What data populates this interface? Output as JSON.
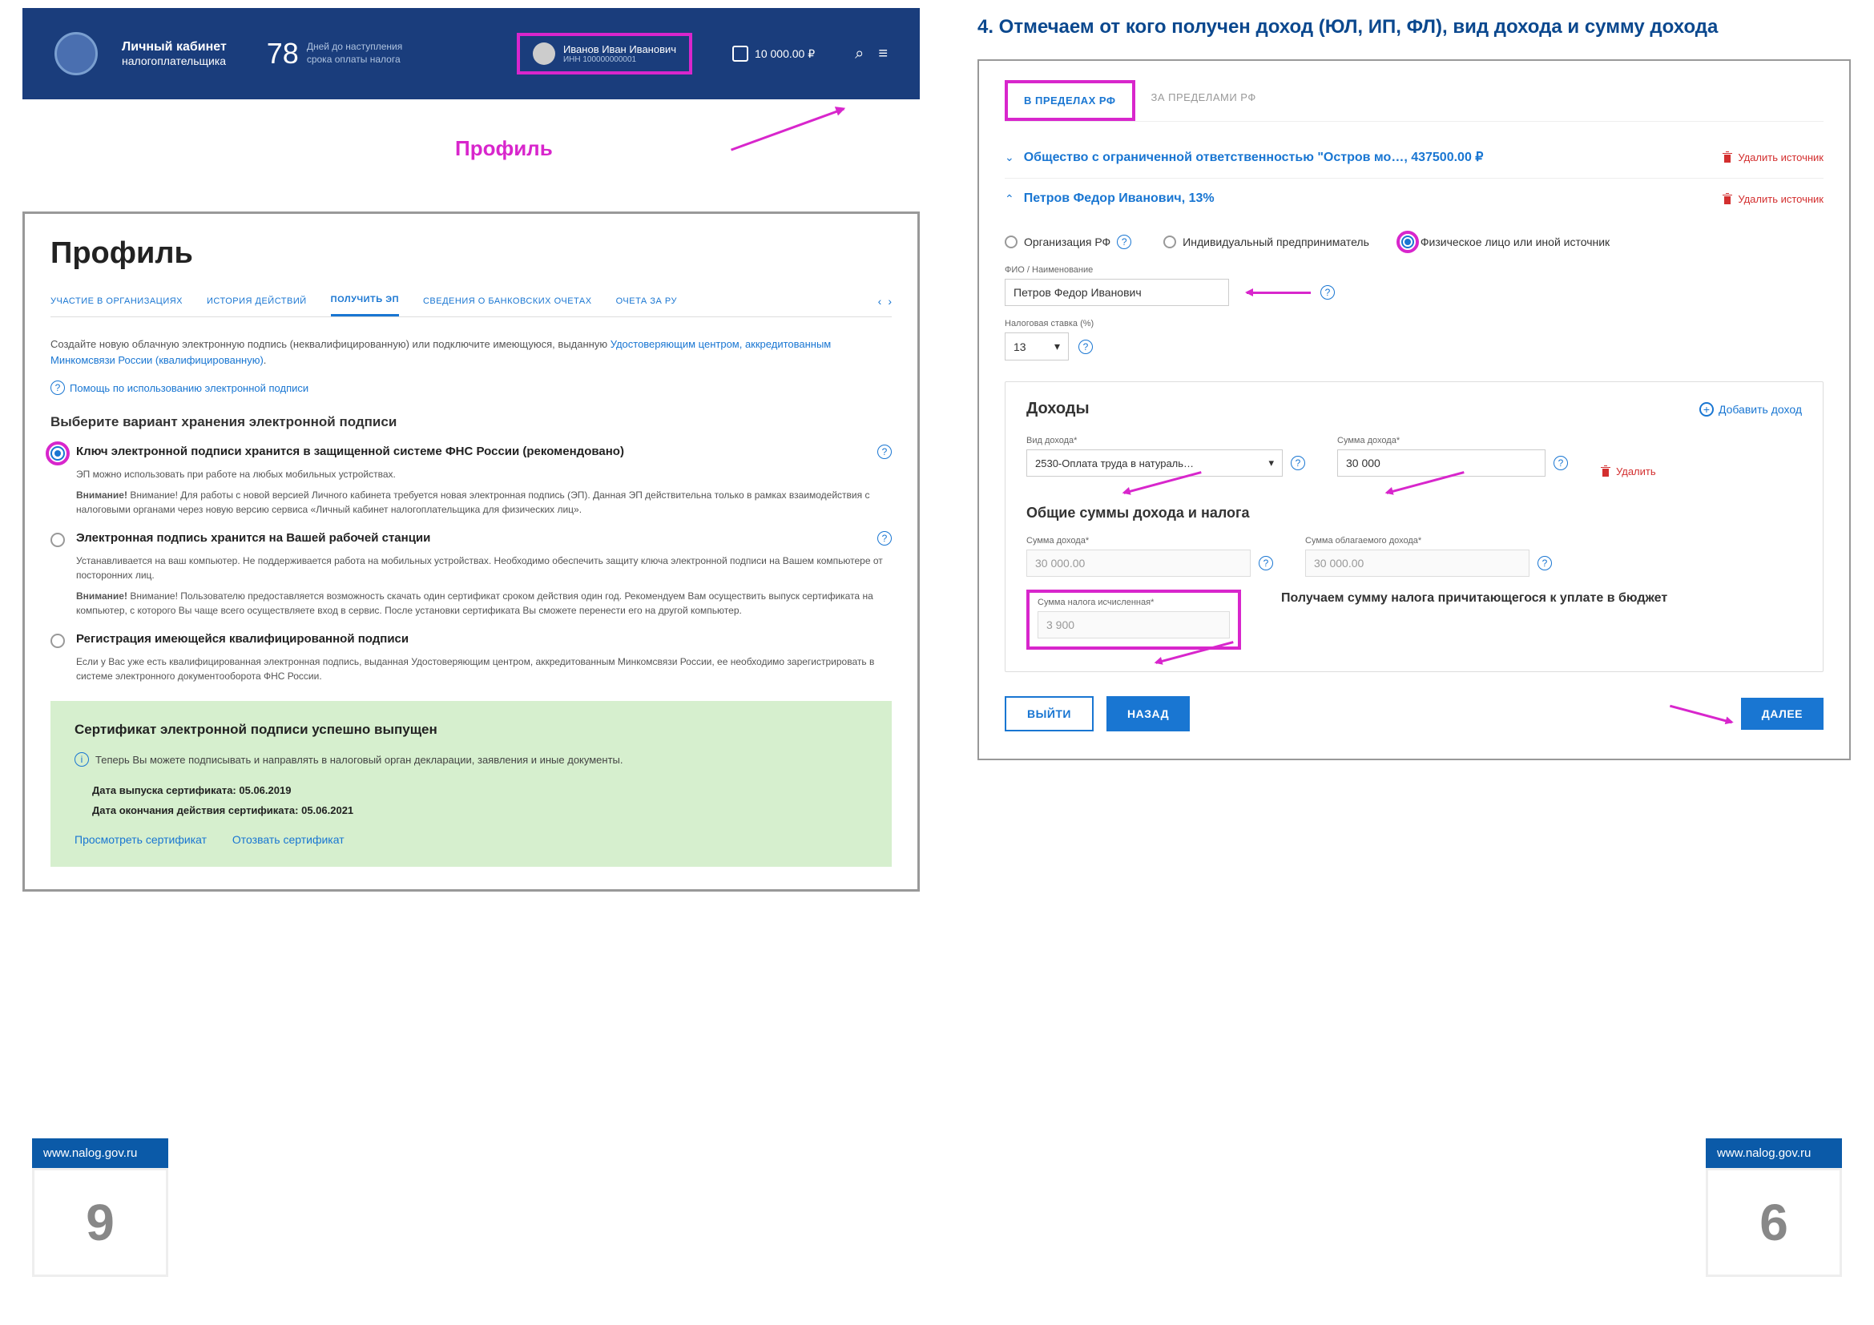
{
  "left": {
    "header": {
      "title1": "Личный кабинет",
      "title2": "налогоплательщика",
      "days_num": "78",
      "days_txt1": "Дней до наступления",
      "days_txt2": "срока оплаты налога",
      "user_name": "Иванов Иван Иванович",
      "user_inn": "ИНН 100000000001",
      "amount": "10 000.00 ₽"
    },
    "profile_label": "Профиль",
    "profile_h": "Профиль",
    "tabs": [
      "УЧАСТИЕ В ОРГАНИЗАЦИЯХ",
      "ИСТОРИЯ ДЕЙСТВИЙ",
      "ПОЛУЧИТЬ ЭП",
      "СВЕДЕНИЯ О БАНКОВСКИХ ОЧЕТАХ",
      "ОЧЕТА ЗА РУ"
    ],
    "intro": "Создайте новую облачную электронную подпись (неквалифицированную) или подключите имеющуюся, выданную ",
    "intro_link": "Удостоверяющим центром, аккредитованным Минкомсвязи России (квалифицированную)",
    "help": "Помощь по использованию электронной подписи",
    "choose_h": "Выберите вариант хранения электронной подписи",
    "opt1": {
      "title": "Ключ электронной подписи хранится в защищенной системе ФНС России (рекомендовано)",
      "desc": "ЭП можно использовать при работе на любых мобильных устройствах.",
      "warn": "Внимание! Для работы с новой версией Личного кабинета требуется новая электронная подпись (ЭП). Данная ЭП действительна только в рамках взаимодействия с налоговыми органами через новую версию сервиса «Личный кабинет налогоплательщика для физических лиц»."
    },
    "opt2": {
      "title": "Электронная подпись хранится на Вашей рабочей станции",
      "desc": "Устанавливается на ваш компьютер. Не поддерживается работа на мобильных устройствах. Необходимо обеспечить защиту ключа электронной подписи на Вашем компьютере от посторонних лиц.",
      "warn": "Внимание! Пользователю предоставляется возможность скачать один сертификат сроком действия один год. Рекомендуем Вам осуществить выпуск сертификата на компьютер, с которого Вы чаще всего осуществляете вход в сервис. После установки сертификата Вы сможете перенести его на другой компьютер."
    },
    "opt3": {
      "title": "Регистрация имеющейся квалифицированной подписи",
      "desc": "Если у Вас уже есть квалифицированная электронная подпись, выданная Удостоверяющим центром, аккредитованным Минкомсвязи России, ее необходимо зарегистрировать в системе электронного документооборота ФНС России."
    },
    "cert": {
      "title": "Сертификат электронной подписи успешно выпущен",
      "msg": "Теперь Вы можете подписывать и направлять в налоговый орган декларации, заявления и иные документы.",
      "date1_label": "Дата выпуска сертификата:",
      "date1": "05.06.2019",
      "date2_label": "Дата окончания действия сертификата:",
      "date2": "05.06.2021",
      "link1": "Просмотреть сертификат",
      "link2": "Отозвать сертификат"
    }
  },
  "right": {
    "heading": "4. Отмечаем от кого получен доход (ЮЛ, ИП, ФЛ), вид дохода и сумму дохода",
    "zone_tabs": [
      "В ПРЕДЕЛАХ РФ",
      "ЗА ПРЕДЕЛАМИ РФ"
    ],
    "src1": "Общество с ограниченной ответственностью \"Остров мо…, 437500.00 ₽",
    "src2": "Петров Федор Иванович, 13%",
    "del_src": "Удалить источник",
    "radios": [
      "Организация РФ",
      "Индивидуальный предприниматель",
      "Физическое лицо или иной источник"
    ],
    "fio_label": "ФИО / Наименование",
    "fio_value": "Петров Федор Иванович",
    "rate_label": "Налоговая ставка (%)",
    "rate_value": "13",
    "income_h": "Доходы",
    "add_income": "Добавить доход",
    "type_label": "Вид дохода*",
    "type_value": "2530-Оплата труда в натураль…",
    "sum_label": "Сумма дохода*",
    "sum_value": "30 000",
    "del_income": "Удалить",
    "totals_h": "Общие суммы дохода и налога",
    "tot1_label": "Сумма дохода*",
    "tot1": "30 000.00",
    "tot2_label": "Сумма облагаемого дохода*",
    "tot2": "30 000.00",
    "tax_label": "Сумма налога исчисленная*",
    "tax_value": "3 900",
    "tax_note": "Получаем сумму налога причитающегося к уплате в бюджет",
    "btn_exit": "ВЫЙТИ",
    "btn_back": "НАЗАД",
    "btn_next": "ДАЛЕЕ"
  },
  "footer": {
    "url": "www.nalog.gov.ru",
    "page_left": "9",
    "page_right": "6"
  }
}
